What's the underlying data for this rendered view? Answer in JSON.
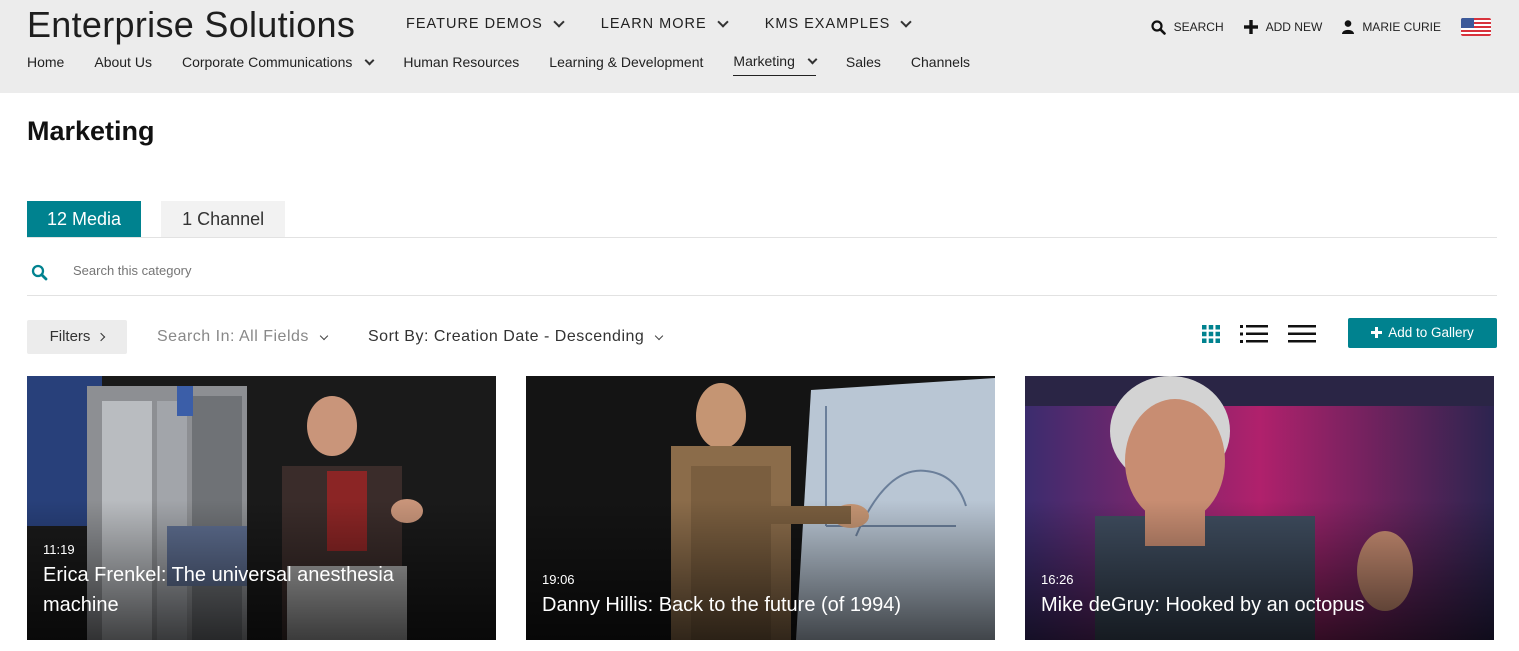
{
  "brand": "Enterprise Solutions",
  "topnav": [
    {
      "label": "FEATURE DEMOS"
    },
    {
      "label": "LEARN MORE"
    },
    {
      "label": "KMS EXAMPLES"
    }
  ],
  "utils": {
    "search": "SEARCH",
    "add_new": "ADD NEW",
    "user": "MARIE CURIE"
  },
  "subnav": [
    {
      "label": "Home"
    },
    {
      "label": "About Us"
    },
    {
      "label": "Corporate Communications"
    },
    {
      "label": "Human Resources"
    },
    {
      "label": "Learning & Development"
    },
    {
      "label": "Marketing"
    },
    {
      "label": "Sales"
    },
    {
      "label": "Channels"
    }
  ],
  "page_title": "Marketing",
  "tabs": {
    "media": "12 Media",
    "channel": "1 Channel"
  },
  "search": {
    "placeholder": "Search this category"
  },
  "toolbar": {
    "filters": "Filters",
    "search_in": "Search In: All Fields",
    "sort_by": "Sort By: Creation Date - Descending",
    "add_to_gallery": "Add to Gallery"
  },
  "colors": {
    "accent": "#00828f",
    "header_bg": "#ececec"
  },
  "media": [
    {
      "duration": "11:19",
      "title": "Erica Frenkel: The universal anesthesia machine"
    },
    {
      "duration": "19:06",
      "title": "Danny Hillis: Back to the future (of 1994)"
    },
    {
      "duration": "16:26",
      "title": "Mike deGruy: Hooked by an octopus"
    }
  ]
}
